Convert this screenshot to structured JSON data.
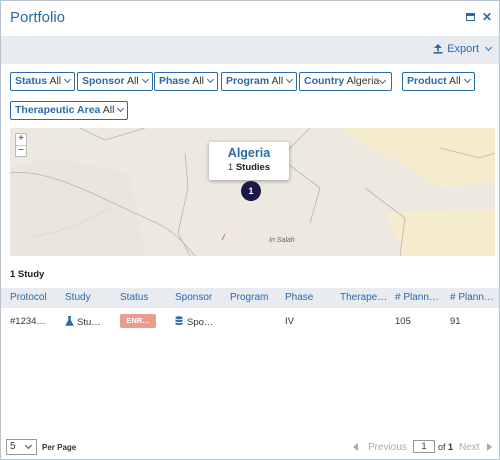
{
  "window": {
    "title": "Portfolio",
    "maximize_icon": "maximize-icon",
    "close_icon": "close-icon"
  },
  "toolbar": {
    "export_label": "Export",
    "export_icon": "upload-icon"
  },
  "filters": [
    {
      "label": "Status",
      "value": "All"
    },
    {
      "label": "Sponsor",
      "value": "All"
    },
    {
      "label": "Phase",
      "value": "All"
    },
    {
      "label": "Program",
      "value": "All"
    },
    {
      "label": "Country",
      "value": "Algeria"
    },
    {
      "label": "Product",
      "value": "All"
    },
    {
      "label": "Therapeutic Area",
      "value": "All"
    }
  ],
  "map": {
    "tooltip_title": "Algeria",
    "tooltip_count": "1",
    "tooltip_unit": "Studies",
    "marker_count": "1",
    "place_label": "In Salah",
    "zoom_in": "+",
    "zoom_out": "−"
  },
  "results": {
    "count_label": "1 Study"
  },
  "table": {
    "columns": [
      "Protocol",
      "Study",
      "Status",
      "Sponsor",
      "Program",
      "Phase",
      "Therape…",
      "# Plann…",
      "# Plann…"
    ],
    "rows": [
      {
        "protocol": "#1234…",
        "study": "Stu…",
        "status": "ENR…",
        "sponsor": "Spo…",
        "program": "",
        "phase": "IV",
        "therapeutic": "",
        "planned1": "105",
        "planned2": "91"
      }
    ]
  },
  "footer": {
    "per_page_value": "5",
    "per_page_label": "Per Page",
    "previous_label": "Previous",
    "page_value": "1",
    "of_label": "of",
    "total_pages": "1",
    "next_label": "Next"
  },
  "colors": {
    "accent": "#2a6aa8",
    "header_bg": "#e8ecf1",
    "status_badge": "#ec9c8d",
    "marker": "#1b1a45"
  }
}
